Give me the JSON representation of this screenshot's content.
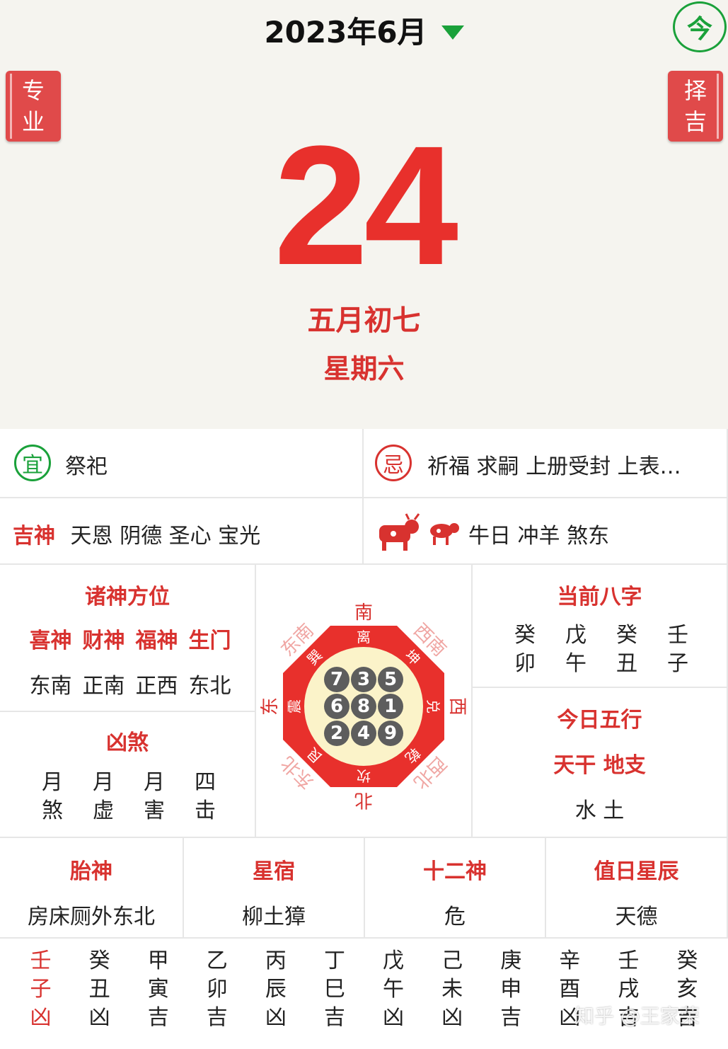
{
  "header": {
    "month_title": "2023年6月",
    "today_label": "今",
    "pro_label": [
      "专",
      "业"
    ],
    "zeji_label": [
      "择",
      "吉"
    ]
  },
  "day": {
    "number": "24",
    "lunar": "五月初七",
    "weekday": "星期六"
  },
  "yi": {
    "seal": "宜",
    "text": "祭祀"
  },
  "ji": {
    "seal": "忌",
    "text": "祈福 求嗣 上册受封 上表…"
  },
  "jishen": {
    "label": "吉神",
    "text": "天恩 阴德 圣心 宝光"
  },
  "zodiac": {
    "text": "牛日 冲羊 煞东"
  },
  "zhushen": {
    "title": "诸神方位",
    "labels": [
      "喜神",
      "财神",
      "福神",
      "生门"
    ],
    "values": [
      "东南",
      "正南",
      "正西",
      "东北"
    ]
  },
  "xiongsha": {
    "title": "凶煞",
    "items": [
      [
        "月",
        "煞"
      ],
      [
        "月",
        "虚"
      ],
      [
        "月",
        "害"
      ],
      [
        "四",
        "击"
      ]
    ]
  },
  "compass": {
    "dirs": [
      "南",
      "西南",
      "西",
      "西北",
      "北",
      "东北",
      "东",
      "东南"
    ],
    "trigrams": [
      "离",
      "坤",
      "兑",
      "乾",
      "坎",
      "艮",
      "震",
      "巽"
    ],
    "nine": [
      7,
      3,
      5,
      6,
      8,
      1,
      2,
      4,
      9
    ]
  },
  "bazi": {
    "title": "当前八字",
    "pillars": [
      [
        "癸",
        "卯"
      ],
      [
        "戊",
        "午"
      ],
      [
        "癸",
        "丑"
      ],
      [
        "壬",
        "子"
      ]
    ]
  },
  "wuxing": {
    "title": "今日五行",
    "subtitle": "天干 地支",
    "value": "水 土"
  },
  "taishen": {
    "title": "胎神",
    "value": "房床厕外东北"
  },
  "xingxiu": {
    "title": "星宿",
    "value": "柳土獐"
  },
  "shiershen": {
    "title": "十二神",
    "value": "危"
  },
  "zhiri": {
    "title": "值日星辰",
    "value": "天德"
  },
  "hours": [
    [
      "壬",
      "子",
      "凶"
    ],
    [
      "癸",
      "丑",
      "凶"
    ],
    [
      "甲",
      "寅",
      "吉"
    ],
    [
      "乙",
      "卯",
      "吉"
    ],
    [
      "丙",
      "辰",
      "凶"
    ],
    [
      "丁",
      "巳",
      "吉"
    ],
    [
      "戊",
      "午",
      "凶"
    ],
    [
      "己",
      "未",
      "凶"
    ],
    [
      "庚",
      "申",
      "吉"
    ],
    [
      "辛",
      "酉",
      "凶"
    ],
    [
      "壬",
      "戌",
      "吉"
    ],
    [
      "癸",
      "亥",
      "吉"
    ]
  ],
  "current_hour_index": 0,
  "watermark": "知乎 @王家荣"
}
